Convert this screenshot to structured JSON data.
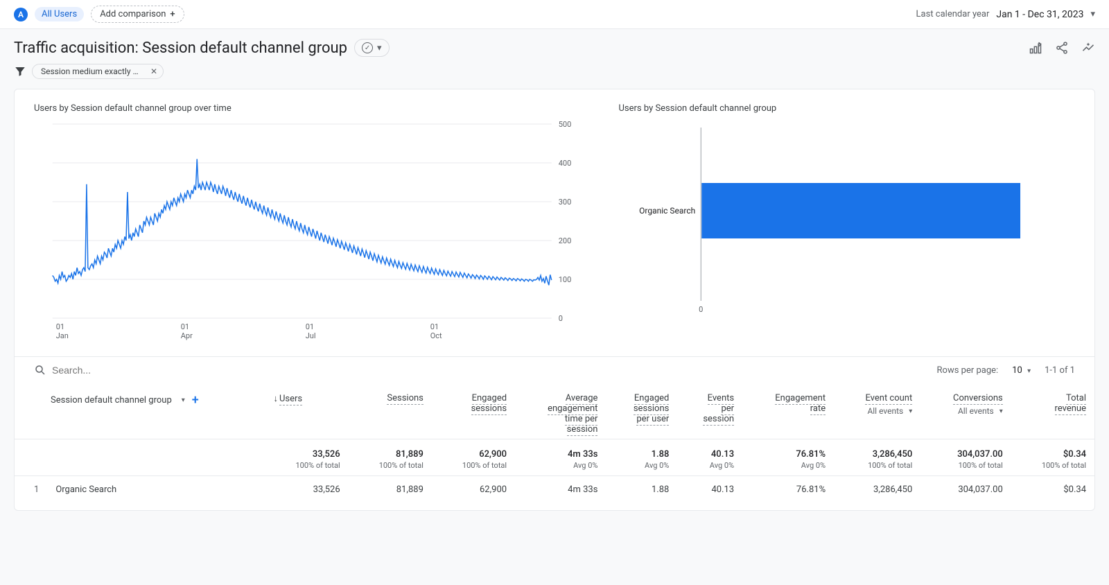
{
  "topbar": {
    "badge": "A",
    "all_users": "All Users",
    "add_comparison": "Add comparison",
    "date_label": "Last calendar year",
    "date_range": "Jan 1 - Dec 31, 2023"
  },
  "title": "Traffic acquisition: Session default channel group",
  "filter": {
    "chip_text": "Session medium exactly m..."
  },
  "charts": {
    "line_title": "Users by Session default channel group over time",
    "bar_title": "Users by Session default channel group"
  },
  "chart_data": {
    "line": {
      "type": "line",
      "xlabel": "",
      "ylabel": "",
      "ylim": [
        0,
        500
      ],
      "yticks": [
        0,
        100,
        200,
        300,
        400,
        500
      ],
      "xticks": [
        "01\nJan",
        "01\nApr",
        "01\nJul",
        "01\nOct"
      ],
      "series": [
        {
          "name": "Organic Search",
          "values": [
            110,
            105,
            95,
            100,
            90,
            110,
            100,
            120,
            105,
            110,
            95,
            100,
            110,
            105,
            115,
            100,
            120,
            110,
            130,
            115,
            120,
            110,
            125,
            130,
            120,
            345,
            130,
            125,
            135,
            140,
            130,
            150,
            140,
            160,
            150,
            140,
            160,
            150,
            170,
            165,
            155,
            180,
            170,
            160,
            180,
            170,
            190,
            180,
            200,
            190,
            180,
            200,
            190,
            210,
            200,
            325,
            205,
            215,
            200,
            220,
            210,
            230,
            220,
            210,
            240,
            230,
            220,
            250,
            240,
            260,
            250,
            240,
            260,
            250,
            240,
            270,
            260,
            250,
            270,
            260,
            280,
            270,
            290,
            280,
            300,
            290,
            280,
            300,
            290,
            310,
            300,
            290,
            310,
            300,
            320,
            310,
            300,
            320,
            310,
            330,
            320,
            310,
            330,
            320,
            340,
            330,
            410,
            335,
            345,
            330,
            350,
            340,
            330,
            350,
            340,
            330,
            350,
            340,
            325,
            345,
            330,
            320,
            340,
            330,
            320,
            340,
            330,
            315,
            335,
            320,
            310,
            330,
            315,
            305,
            325,
            310,
            300,
            320,
            305,
            295,
            315,
            300,
            290,
            310,
            295,
            285,
            305,
            290,
            280,
            300,
            285,
            275,
            295,
            280,
            270,
            290,
            275,
            265,
            285,
            270,
            260,
            280,
            265,
            255,
            275,
            260,
            250,
            270,
            255,
            245,
            265,
            250,
            240,
            260,
            245,
            235,
            255,
            240,
            230,
            250,
            235,
            225,
            245,
            230,
            220,
            240,
            225,
            215,
            235,
            222,
            210,
            230,
            218,
            205,
            225,
            212,
            200,
            220,
            208,
            196,
            215,
            204,
            192,
            210,
            200,
            188,
            206,
            196,
            184,
            202,
            192,
            180,
            198,
            188,
            176,
            194,
            184,
            172,
            190,
            180,
            168,
            186,
            176,
            164,
            182,
            172,
            160,
            178,
            168,
            156,
            174,
            164,
            152,
            170,
            160,
            148,
            166,
            156,
            145,
            162,
            152,
            142,
            158,
            148,
            139,
            155,
            145,
            136,
            152,
            142,
            133,
            149,
            139,
            130,
            146,
            136,
            128,
            143,
            134,
            126,
            141,
            132,
            124,
            139,
            130,
            122,
            137,
            128,
            120,
            135,
            126,
            118,
            133,
            124,
            116,
            131,
            122,
            115,
            129,
            120,
            113,
            127,
            118,
            112,
            125,
            117,
            110,
            123,
            115,
            109,
            121,
            114,
            108,
            120,
            113,
            107,
            119,
            112,
            106,
            118,
            111,
            105,
            116,
            110,
            104,
            114,
            109,
            103,
            112,
            108,
            102,
            111,
            107,
            101,
            110,
            106,
            100,
            109,
            105,
            100,
            108,
            104,
            99,
            107,
            103,
            99,
            106,
            102,
            98,
            105,
            102,
            98,
            104,
            101,
            97,
            103,
            101,
            97,
            102,
            100,
            96,
            102,
            100,
            96,
            101,
            99,
            95,
            100,
            99,
            95,
            100,
            98,
            95,
            99,
            98,
            100,
            105,
            98,
            110,
            95,
            102,
            90,
            108,
            96,
            85,
            112,
            98
          ]
        }
      ]
    },
    "bar": {
      "type": "bar",
      "categories": [
        "Organic Search"
      ],
      "values": [
        33526
      ],
      "xlim": [
        0,
        35000
      ],
      "xtick0": "0"
    }
  },
  "table_controls": {
    "search_placeholder": "Search...",
    "rows_label": "Rows per page:",
    "rows_value": "10",
    "range": "1-1 of 1"
  },
  "table": {
    "dimension_header": "Session default channel group",
    "columns": [
      {
        "lines": [
          "Users"
        ],
        "sort": true
      },
      {
        "lines": [
          "Sessions"
        ]
      },
      {
        "lines": [
          "Engaged",
          "sessions"
        ]
      },
      {
        "lines": [
          "Average",
          "engagement",
          "time per",
          "session"
        ]
      },
      {
        "lines": [
          "Engaged",
          "sessions",
          "per user"
        ]
      },
      {
        "lines": [
          "Events",
          "per",
          "session"
        ]
      },
      {
        "lines": [
          "Engagement",
          "rate"
        ]
      },
      {
        "lines": [
          "Event count"
        ],
        "sub": "All events"
      },
      {
        "lines": [
          "Conversions"
        ],
        "sub": "All events"
      },
      {
        "lines": [
          "Total",
          "revenue"
        ]
      }
    ],
    "summary": [
      {
        "big": "33,526",
        "sub": "100% of total"
      },
      {
        "big": "81,889",
        "sub": "100% of total"
      },
      {
        "big": "62,900",
        "sub": "100% of total"
      },
      {
        "big": "4m 33s",
        "sub": "Avg 0%"
      },
      {
        "big": "1.88",
        "sub": "Avg 0%"
      },
      {
        "big": "40.13",
        "sub": "Avg 0%"
      },
      {
        "big": "76.81%",
        "sub": "Avg 0%"
      },
      {
        "big": "3,286,450",
        "sub": "100% of total"
      },
      {
        "big": "304,037.00",
        "sub": "100% of total"
      },
      {
        "big": "$0.34",
        "sub": "100% of total"
      }
    ],
    "rows": [
      {
        "idx": "1",
        "label": "Organic Search",
        "cells": [
          "33,526",
          "81,889",
          "62,900",
          "4m 33s",
          "1.88",
          "40.13",
          "76.81%",
          "3,286,450",
          "304,037.00",
          "$0.34"
        ]
      }
    ]
  }
}
